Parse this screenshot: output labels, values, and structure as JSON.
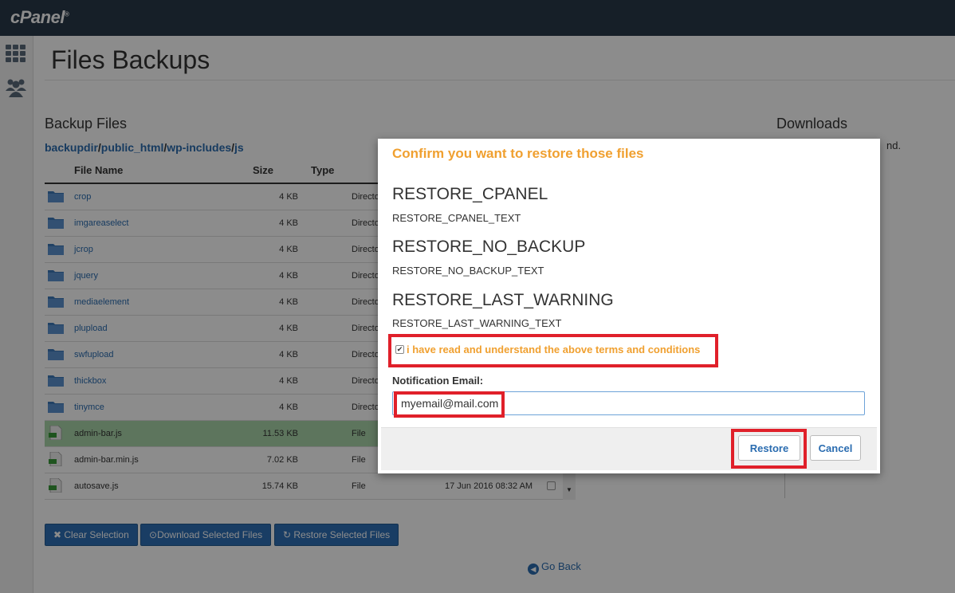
{
  "app": {
    "logo_text": "cPanel",
    "logo_mark": "®"
  },
  "sidebar": {
    "items": [
      {
        "icon": "grid-icon"
      },
      {
        "icon": "users-icon"
      }
    ]
  },
  "page": {
    "title": "Files Backups",
    "section_title": "Backup Files",
    "downloads_title": "Downloads",
    "downloads_text": "nd."
  },
  "breadcrumb": {
    "parts": [
      "backupdir",
      "public_html",
      "wp-includes",
      "js"
    ],
    "separator": "/"
  },
  "table": {
    "headers": {
      "name": "File Name",
      "size": "Size",
      "type": "Type"
    },
    "rows": [
      {
        "name": "crop",
        "size": "4 KB",
        "type": "Directory",
        "kind": "folder"
      },
      {
        "name": "imgareaselect",
        "size": "4 KB",
        "type": "Directory",
        "kind": "folder"
      },
      {
        "name": "jcrop",
        "size": "4 KB",
        "type": "Directory",
        "kind": "folder"
      },
      {
        "name": "jquery",
        "size": "4 KB",
        "type": "Directory",
        "kind": "folder"
      },
      {
        "name": "mediaelement",
        "size": "4 KB",
        "type": "Directory",
        "kind": "folder"
      },
      {
        "name": "plupload",
        "size": "4 KB",
        "type": "Directory",
        "kind": "folder"
      },
      {
        "name": "swfupload",
        "size": "4 KB",
        "type": "Directory",
        "kind": "folder"
      },
      {
        "name": "thickbox",
        "size": "4 KB",
        "type": "Directory",
        "kind": "folder"
      },
      {
        "name": "tinymce",
        "size": "4 KB",
        "type": "Directory",
        "kind": "folder"
      },
      {
        "name": "admin-bar.js",
        "size": "11.53 KB",
        "type": "File",
        "kind": "file",
        "selected": true
      },
      {
        "name": "admin-bar.min.js",
        "size": "7.02 KB",
        "type": "File",
        "kind": "file"
      },
      {
        "name": "autosave.js",
        "size": "15.74 KB",
        "type": "File",
        "kind": "file",
        "date": "17 Jun 2016 08:32 AM"
      }
    ]
  },
  "buttons": {
    "clear": "Clear Selection",
    "download": "Download Selected Files",
    "restore": "Restore Selected Files"
  },
  "go_back": "Go Back",
  "modal": {
    "title": "Confirm you want to restore those files",
    "sections": [
      {
        "heading": "RESTORE_CPANEL",
        "text": "RESTORE_CPANEL_TEXT"
      },
      {
        "heading": "RESTORE_NO_BACKUP",
        "text": "RESTORE_NO_BACKUP_TEXT"
      },
      {
        "heading": "RESTORE_LAST_WARNING",
        "text": "RESTORE_LAST_WARNING_TEXT"
      }
    ],
    "terms_label": "i have read and understand the above terms and conditions",
    "email_label": "Notification Email:",
    "email_value": "myemail@mail.com",
    "restore_button": "Restore",
    "cancel_button": "Cancel"
  },
  "colors": {
    "topbar": "#293a4a",
    "link": "#2a6cb0",
    "accent_orange": "#f0a030",
    "highlight_red": "#e0202a",
    "button_blue": "#2f70b7",
    "selected_row": "#a9d5a9"
  }
}
